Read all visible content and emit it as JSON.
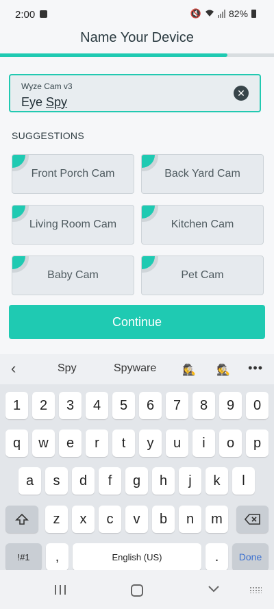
{
  "status_bar": {
    "time": "2:00",
    "battery": "82%",
    "icons": [
      "gallery-icon",
      "mute-icon",
      "wifi-icon",
      "signal-icon",
      "battery-icon"
    ]
  },
  "header": {
    "title": "Name Your Device",
    "progress_fraction": 0.83
  },
  "name_field": {
    "label": "Wyze Cam v3",
    "value_prefix": "Eye ",
    "value_underlined": "Spy",
    "clear_icon": "close-icon"
  },
  "suggestions": {
    "heading": "SUGGESTIONS",
    "items": [
      "Front Porch Cam",
      "Back Yard Cam",
      "Living Room Cam",
      "Kitchen Cam",
      "Baby Cam",
      "Pet Cam"
    ]
  },
  "continue_label": "Continue",
  "keyboard": {
    "predictions": [
      "Spy",
      "Spyware"
    ],
    "emoji": [
      "🕵‍♀",
      "🕵"
    ],
    "more": "•••",
    "row1": [
      "1",
      "2",
      "3",
      "4",
      "5",
      "6",
      "7",
      "8",
      "9",
      "0"
    ],
    "row2": [
      "q",
      "w",
      "e",
      "r",
      "t",
      "y",
      "u",
      "i",
      "o",
      "p"
    ],
    "row3": [
      "a",
      "s",
      "d",
      "f",
      "g",
      "h",
      "j",
      "k",
      "l"
    ],
    "row4": [
      "z",
      "x",
      "c",
      "v",
      "b",
      "n",
      "m"
    ],
    "symbols": "!#1",
    "comma": ",",
    "space": "English (US)",
    "period": ".",
    "done": "Done"
  },
  "colors": {
    "accent": "#1fcab2",
    "chip_bg": "#e6eaee",
    "background": "#f6f7f9"
  }
}
